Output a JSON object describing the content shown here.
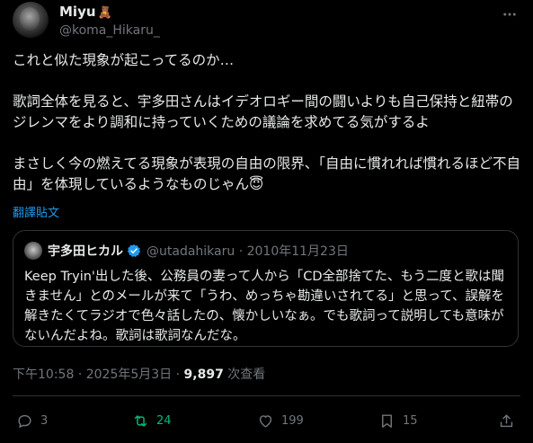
{
  "author": {
    "display_name": "Miyu",
    "emoji": "🧸",
    "handle": "@koma_Hikaru_"
  },
  "tweet": {
    "text": "これと似た現象が起こってるのか…\n\n歌詞全体を見ると、宇多田さんはイデオロギー間の闘いよりも自己保持と紐帯のジレンマをより調和に持っていくための議論を求めてる気がするよ\n\nまさしく今の燃えてる現象が表現の自由の限界、「自由に慣れれば慣れるほど不自由」を体現しているようなものじゃん😇",
    "translate_label": "翻譯貼文"
  },
  "quote": {
    "name": "宇多田ヒカル",
    "handle": "@utadahikaru",
    "separator": "·",
    "date": "2010年11月23日",
    "text": "Keep Tryin'出した後、公務員の妻って人から「CD全部捨てた、もう二度と歌は聞きません」とのメールが来て「うわ、めっちゃ勘違いされてる」と思って、誤解を解きたくてラジオで色々話したの、懐かしいなぁ。でも歌詞って説明しても意味がないんだよね。歌詞は歌詞なんだな。"
  },
  "meta": {
    "time": "下午10:58",
    "sep1": "·",
    "date": "2025年5月3日",
    "sep2": "·",
    "views": "9,897",
    "views_label": "次查看"
  },
  "actions": {
    "replies": "3",
    "retweets": "24",
    "likes": "199",
    "bookmarks": "15"
  },
  "colors": {
    "background": "#000000",
    "text": "#e7e9ea",
    "secondary": "#71767b",
    "link": "#1d9bf0",
    "retweet": "#00ba7c",
    "border": "#2f3336"
  }
}
